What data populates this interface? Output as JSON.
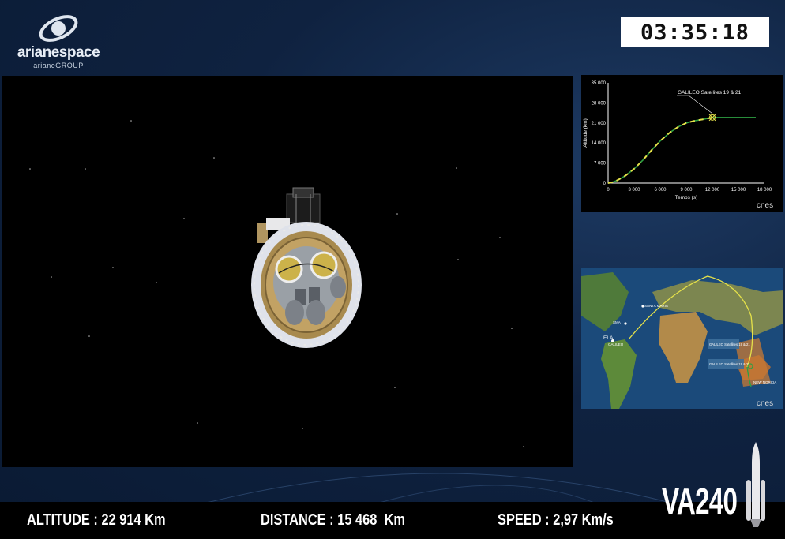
{
  "branding": {
    "company": "arianespace",
    "group": "arianeGROUP",
    "flight": "VA240"
  },
  "countdown": "03:35:18",
  "telemetry": {
    "altitude_label": "ALTITUDE",
    "altitude_value": "22 914 Km",
    "distance_label": "DISTANCE",
    "distance_value": "15 468  Km",
    "speed_label": "SPEED",
    "speed_value": "2,97 Km/s",
    "separator": ":"
  },
  "altitude_chart": {
    "credit": "cnes",
    "chart_data": {
      "type": "line",
      "title": "",
      "xlabel": "Temps (s)",
      "ylabel": "Altitude (km)",
      "xlim": [
        0,
        18000
      ],
      "ylim": [
        0,
        35000
      ],
      "x_ticks": [
        "0",
        "3 000",
        "6 000",
        "9 000",
        "12 000",
        "15 000",
        "18 000"
      ],
      "y_ticks": [
        "0",
        "7 000",
        "14 000",
        "21 000",
        "28 000",
        "35 000"
      ],
      "annotation": "GALILEO Satellites 19 & 21",
      "series": [
        {
          "x": [
            0,
            500,
            1000,
            1500,
            2000,
            3000,
            4000,
            5000,
            6000,
            7000,
            8000,
            9000,
            10000,
            11000,
            11500,
            12000,
            13000,
            14000,
            15000,
            16000,
            17000
          ],
          "values": [
            0,
            300,
            900,
            1700,
            2600,
            5000,
            8000,
            11500,
            14700,
            17400,
            19500,
            21000,
            21800,
            22300,
            22600,
            22914,
            22914,
            22914,
            22914,
            22914,
            22914
          ]
        }
      ],
      "current": {
        "x": 12000,
        "y": 22914
      },
      "colors": {
        "track": "#2ea043",
        "progress": "#e5e14a",
        "axis": "#ffffff"
      }
    }
  },
  "ground_track_map": {
    "credit": "cnes",
    "labels": {
      "launch": "ELA",
      "site": "GALILEO",
      "sma": "SMA",
      "santa_maria": "SANTA MARIA",
      "sep1": "GALILEO Satellites 19 & 21",
      "sep2": "GALILEO Satellites 19 & 21",
      "new_norcia": "NEW NORCIA"
    }
  }
}
